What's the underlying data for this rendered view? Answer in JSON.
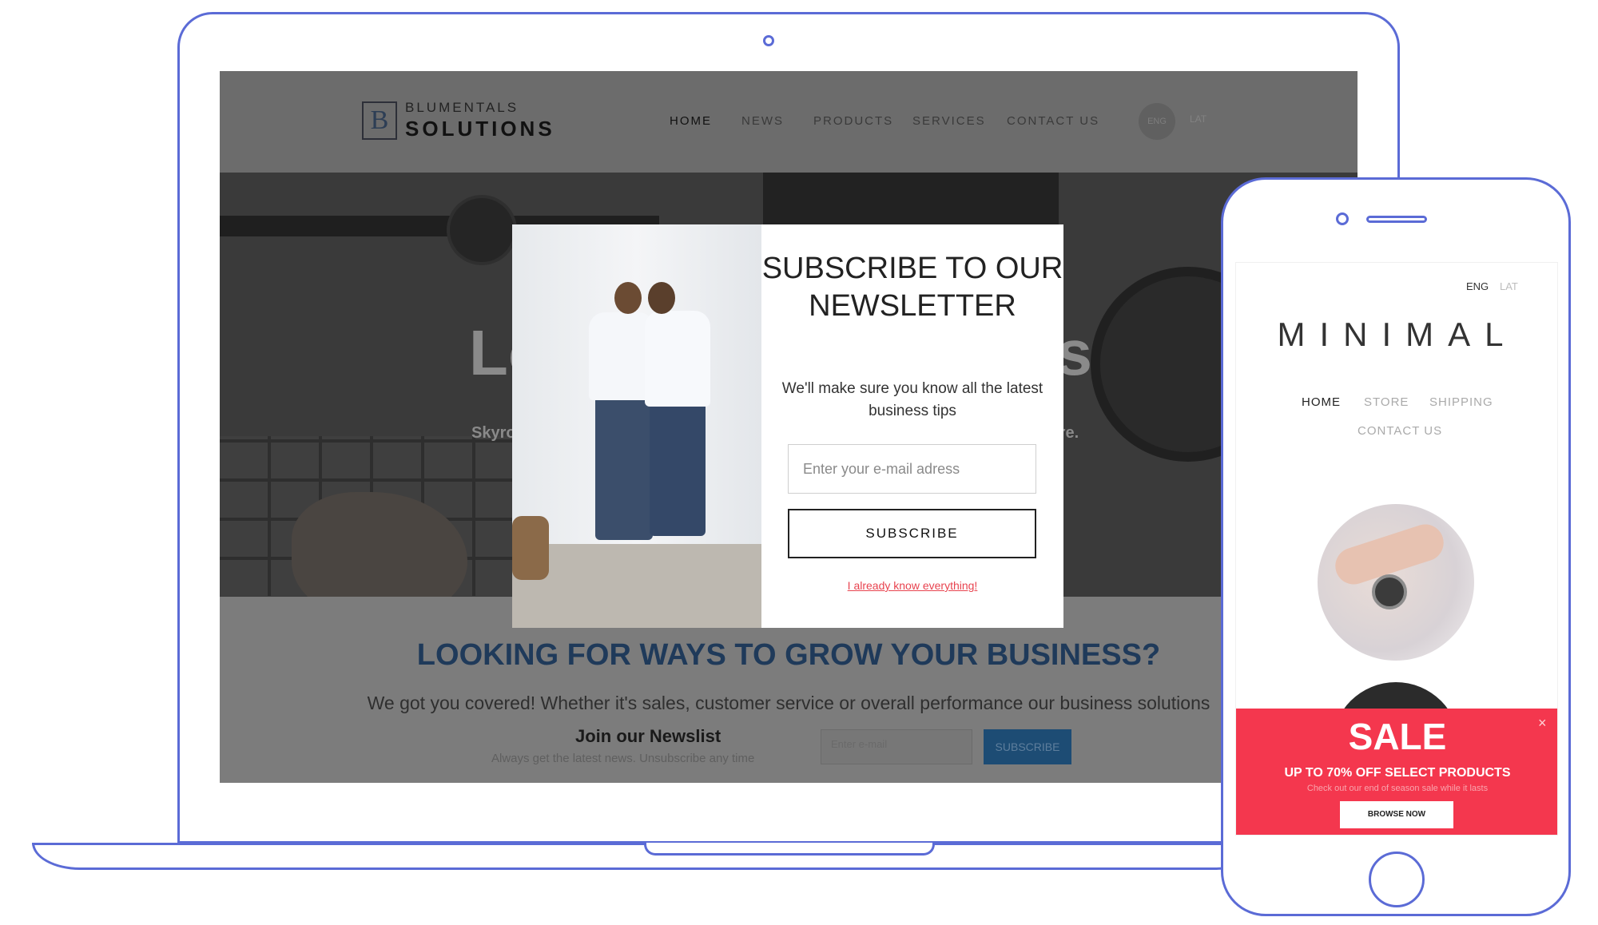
{
  "laptop": {
    "header": {
      "logo_mark": "B",
      "logo_top": "BLUMENTALS",
      "logo_bottom": "SOLUTIONS",
      "nav": [
        "HOME",
        "NEWS",
        "PRODUCTS",
        "SERVICES",
        "CONTACT US"
      ],
      "lang_active": "ENG",
      "lang_other": "LAT"
    },
    "hero": {
      "title_left": "Lo",
      "title_right": "ss",
      "subtitle_left": "Skyro",
      "subtitle_right": "ware."
    },
    "section": {
      "heading": "LOOKING FOR WAYS TO GROW YOUR BUSINESS?",
      "text": "We got you covered! Whether it's sales, customer service or overall performance our business solutions",
      "newsletter_title": "Join our Newslist",
      "newsletter_sub": "Always get the latest news. Unsubscribe any time",
      "email_placeholder": "Enter e-mail",
      "subscribe_label": "SUBSCRIBE"
    },
    "popup": {
      "title": "SUBSCRIBE TO OUR NEWSLETTER",
      "text": "We'll make sure you know all the latest business tips",
      "email_placeholder": "Enter your e-mail adress",
      "subscribe_label": "SUBSCRIBE",
      "dismiss_link": "I already know everything!"
    }
  },
  "phone": {
    "lang_active": "ENG",
    "lang_other": "LAT",
    "logo": "MINIMAL",
    "nav": [
      "HOME",
      "STORE",
      "SHIPPING",
      "CONTACT US"
    ],
    "banner": {
      "title": "SALE",
      "subtitle": "UP TO 70% OFF SELECT PRODUCTS",
      "text": "Check out our end of season sale while it lasts",
      "button": "BROWSE NOW",
      "close": "×"
    }
  },
  "colors": {
    "device_outline": "#5b6bd6",
    "popup_link": "#e8434f",
    "sale_banner": "#f4374e",
    "heading_blue": "#1f3a5a"
  }
}
